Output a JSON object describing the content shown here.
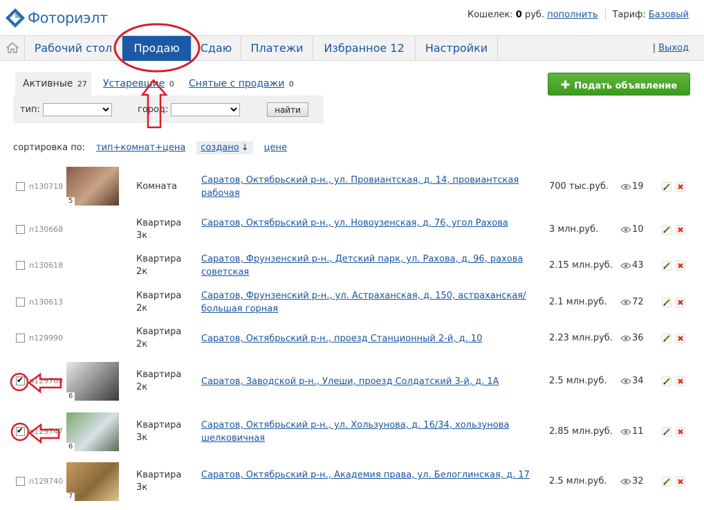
{
  "brand": {
    "name": "Фоториэлт"
  },
  "account": {
    "wallet_label": "Кошелек:",
    "wallet_amount": "0",
    "wallet_currency": "руб.",
    "topup_link": "пополнить",
    "tariff_label": "Тариф:",
    "tariff_value": "Базовый"
  },
  "nav": {
    "items": [
      {
        "label": "Рабочий стол"
      },
      {
        "label": "Продаю"
      },
      {
        "label": "Сдаю"
      },
      {
        "label": "Платежи"
      },
      {
        "label": "Избранное 12"
      },
      {
        "label": "Настройки"
      }
    ],
    "active_index": 1,
    "logout": "Выход",
    "logout_separator": "|"
  },
  "tabs": [
    {
      "label": "Активные",
      "count": "27"
    },
    {
      "label": "Устаревшие",
      "count": "0"
    },
    {
      "label": "Снятые с продажи",
      "count": "0"
    }
  ],
  "filter": {
    "type_label": "тип:",
    "type_value": "",
    "city_label": "город:",
    "city_value": "",
    "find_button": "найти"
  },
  "add_button": {
    "label": "Подать объявление",
    "icon": "plus-icon"
  },
  "sort": {
    "label": "сортировка по:",
    "options": [
      {
        "label": "тип+комнат+цена"
      },
      {
        "label": "создано",
        "active": true,
        "direction": "↓"
      },
      {
        "label": "цене"
      }
    ]
  },
  "listings": [
    {
      "id": "п130718",
      "checked": false,
      "photo_count": "5",
      "type": "Комната",
      "address": "Саратов, Октябрьский р-н., ул. Провиантская, д. 14, провиантская рабочая",
      "price": "700 тыс.руб.",
      "views": "19"
    },
    {
      "id": "п130668",
      "checked": false,
      "photo_count": null,
      "type": "Квартира 3к",
      "address": "Саратов, Октябрьский р-н., ул. Новоузенская, д. 76, угол Рахова",
      "price": "3 млн.руб.",
      "views": "10"
    },
    {
      "id": "п130618",
      "checked": false,
      "photo_count": null,
      "type": "Квартира 2к",
      "address": "Саратов, Фрунзенский р-н., Детский парк, ул. Рахова, д. 96, рахова советская",
      "price": "2.15 млн.руб.",
      "views": "43"
    },
    {
      "id": "п130613",
      "checked": false,
      "photo_count": null,
      "type": "Квартира 2к",
      "address": "Саратов, Фрунзенский р-н., ул. Астраханская, д. 150, астраханская/ большая горная",
      "price": "2.1 млн.руб.",
      "views": "72"
    },
    {
      "id": "п129990",
      "checked": false,
      "photo_count": null,
      "type": "Квартира 2к",
      "address": "Саратов, Октябрьский р-н., проезд Станционный 2-й, д. 10",
      "price": "2.23 млн.руб.",
      "views": "36"
    },
    {
      "id": "п129760",
      "checked": true,
      "photo_count": "6",
      "type": "Квартира 2к",
      "address": "Саратов, Заводской р-н., Улеши, проезд Солдатский 3-й, д. 1А",
      "price": "2.5 млн.руб.",
      "views": "34"
    },
    {
      "id": "п129747",
      "checked": true,
      "photo_count": "6",
      "type": "Квартира 3к",
      "address": "Саратов, Октябрьский р-н., ул. Хользунова, д. 16/34, хользунова шелковичная",
      "price": "2.85 млн.руб.",
      "views": "11"
    },
    {
      "id": "п129740",
      "checked": false,
      "photo_count": "7",
      "type": "Квартира 3к",
      "address": "Саратов, Октябрьский р-н., Академия права, ул. Белоглинская, д. 17",
      "price": "2.5 млн.руб.",
      "views": "32"
    }
  ],
  "colors": {
    "accent": "#1d5aa6",
    "link": "#1a55a0",
    "add_button": "#4caa28",
    "annotation": "#d81e26"
  }
}
